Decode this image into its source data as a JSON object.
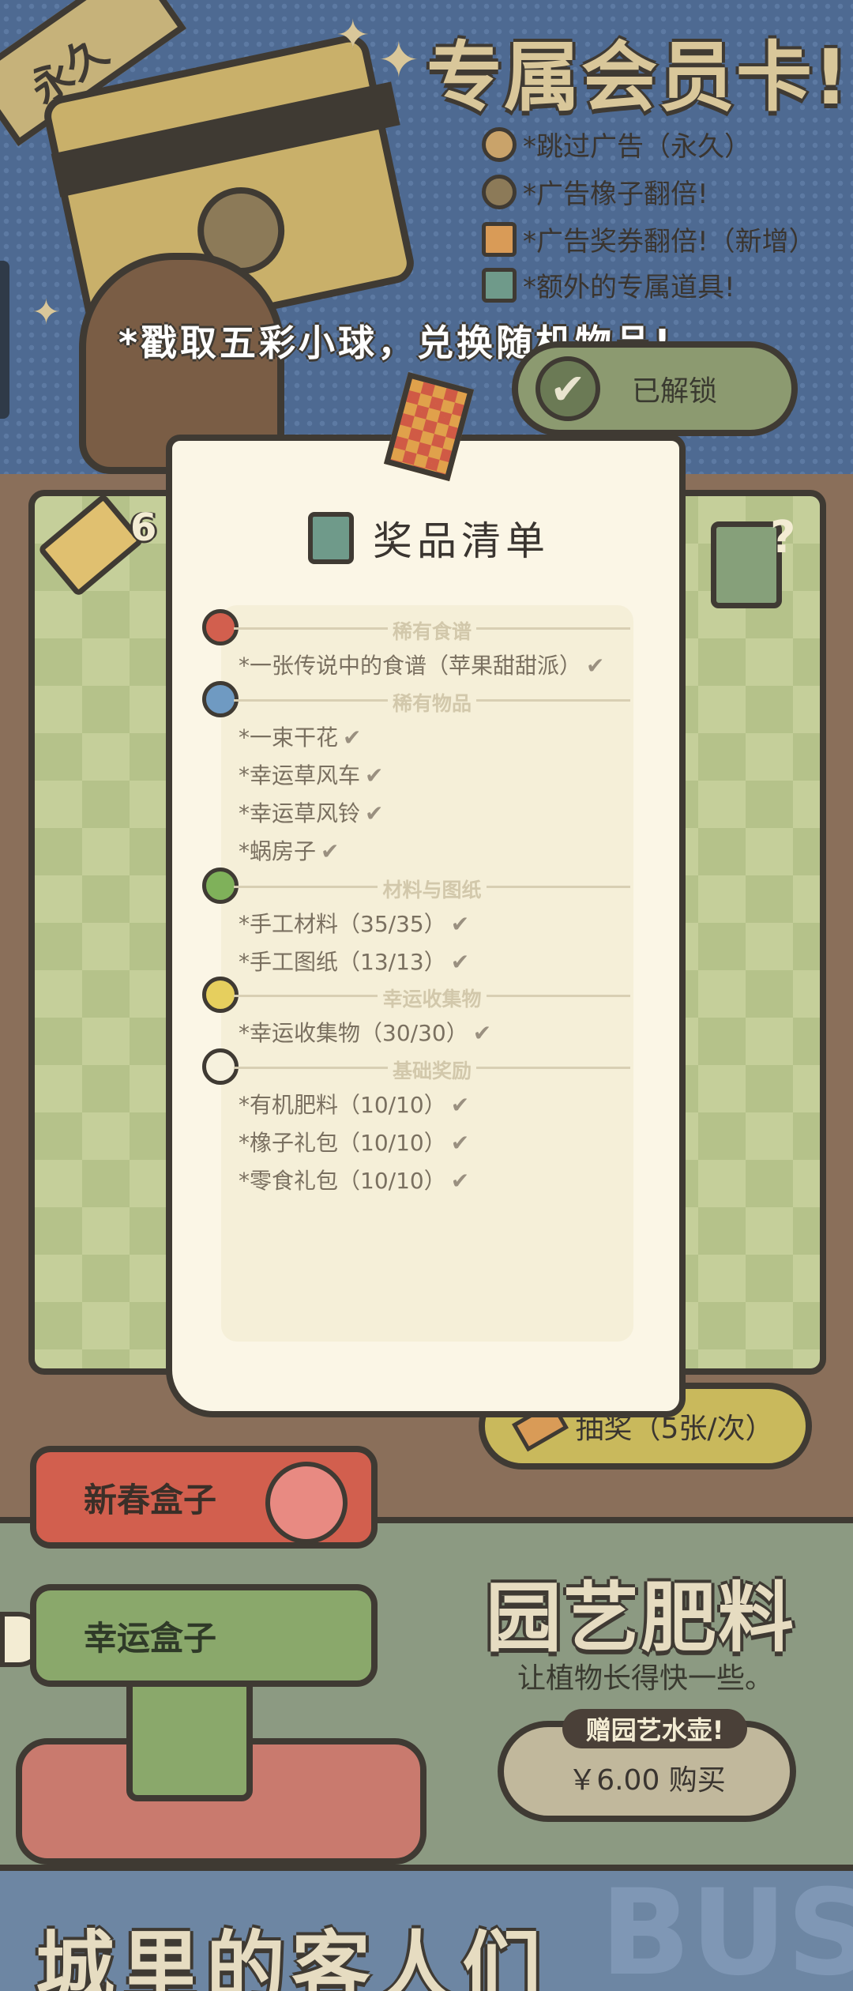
{
  "membership": {
    "ribbon": "永久",
    "title": "专属会员卡!",
    "perks": [
      "*跳过广告（永久）",
      "*广告橡子翻倍!",
      "*广告奖券翻倍!（新增）",
      "*额外的专属道具!"
    ],
    "exchange_text": "*戳取五彩小球，兑换随机物品!",
    "unlocked_label": "已解锁"
  },
  "machine": {
    "ticket_count": "6",
    "draw_label": "抽奖（5张/次）"
  },
  "dialog": {
    "title": "奖品清单",
    "categories": [
      {
        "name": "稀有食谱",
        "ball_color": "#d25f4e",
        "items": [
          "*一张传说中的食谱（苹果甜甜派）"
        ]
      },
      {
        "name": "稀有物品",
        "ball_color": "#6f9ac2",
        "items": [
          "*一束干花",
          "*幸运草风车",
          "*幸运草风铃",
          "*蜗房子"
        ]
      },
      {
        "name": "材料与图纸",
        "ball_color": "#7fb15a",
        "items": [
          "*手工材料（35/35）",
          "*手工图纸（13/13）"
        ]
      },
      {
        "name": "幸运收集物",
        "ball_color": "#e6cf5e",
        "items": [
          "*幸运收集物（30/30）"
        ]
      },
      {
        "name": "基础奖励",
        "ball_color": "#f6f1dd",
        "items": [
          "*有机肥料（10/10）",
          "*橡子礼包（10/10）",
          "*零食礼包（10/10）"
        ]
      }
    ],
    "check_mark": "✔"
  },
  "shop": {
    "tabs": [
      "新春盒子",
      "幸运盒子"
    ],
    "product_title": "园艺肥料",
    "product_subtitle": "让植物长得快一些。",
    "gift_tag": "赠园艺水壶!",
    "buy_label": "￥6.00 购买"
  },
  "bottom": {
    "title": "城里的客人们",
    "sign": "BUS"
  },
  "colors": {
    "banner_blue": "#4e6a92",
    "paper": "#fbf6e6",
    "outline": "#3f3a33",
    "check_board_light": "#c5cf9a",
    "check_board_dark": "#b5c28a"
  },
  "icons": [
    "acorn-card-icon",
    "no-ads-icon",
    "acorn-icon",
    "ticket-icon",
    "gift-icon",
    "checkmark-icon",
    "question-gift-icon",
    "flower-icon"
  ]
}
